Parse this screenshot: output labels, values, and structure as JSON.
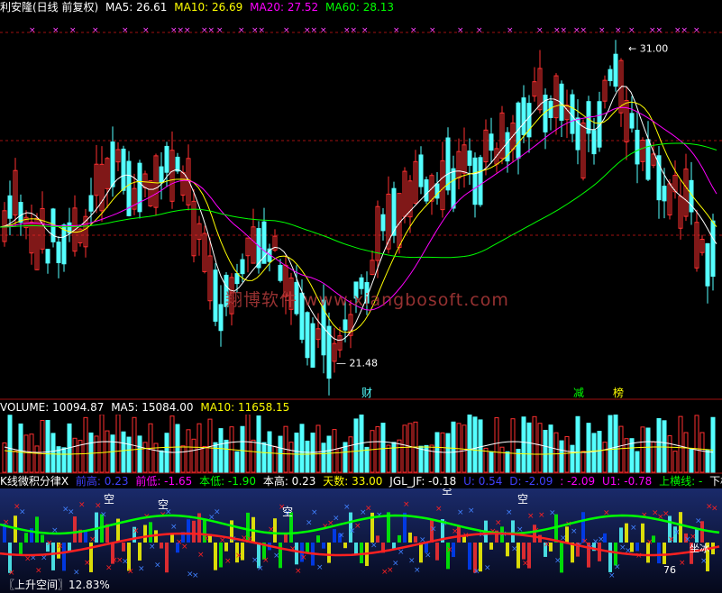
{
  "main": {
    "title": "利安隆(日线 前复权)",
    "ma": [
      {
        "label": "MA5: 26.61",
        "color": "#ffffff"
      },
      {
        "label": "MA10: 26.69",
        "color": "#ffff00"
      },
      {
        "label": "MA20: 27.52",
        "color": "#ff00ff"
      },
      {
        "label": "MA60: 28.13",
        "color": "#00ff00"
      }
    ],
    "high_label": "31.00",
    "low_label": "21.48",
    "markers": {
      "cai": "财",
      "jian": "减",
      "bang": "榜"
    },
    "watermark": "翔博软件 www.xiangbosoft.com"
  },
  "volume": {
    "stats": [
      {
        "label": "VOLUME: 10094.87",
        "color": "#ffffff"
      },
      {
        "label": "MA5: 15084.00",
        "color": "#ffffff"
      },
      {
        "label": "MA10: 11658.15",
        "color": "#ffff00"
      }
    ]
  },
  "indicator": {
    "title": "K线微积分律X",
    "stats": [
      {
        "label": "前高: 0.23",
        "color": "#4040ff"
      },
      {
        "label": "前低: -1.65",
        "color": "#ff00ff"
      },
      {
        "label": "本低: -1.90",
        "color": "#00ff00"
      },
      {
        "label": "本高: 0.23",
        "color": "#ffffff"
      },
      {
        "label": "天数: 33.00",
        "color": "#ffff00"
      },
      {
        "label": "JGL_JF: -0.18",
        "color": "#ffffff"
      },
      {
        "label": "U: 0.54",
        "color": "#4040ff"
      },
      {
        "label": "D: -2.09",
        "color": "#4040ff"
      },
      {
        "label": ": -2.09",
        "color": "#ff00ff"
      },
      {
        "label": "U1: -0.78",
        "color": "#ff00ff"
      },
      {
        "label": "上横线: -",
        "color": "#00ff00"
      },
      {
        "label": "下横线",
        "color": "#ffffff"
      }
    ],
    "kong_labels": [
      "空",
      "空",
      "空",
      "空",
      "空"
    ],
    "number_label": "76",
    "text_label": "坐冰",
    "footer": "〖上升空间〗12.83%"
  },
  "colors": {
    "up": "#ff3030",
    "down": "#54ffff",
    "grid": "#a01010"
  }
}
